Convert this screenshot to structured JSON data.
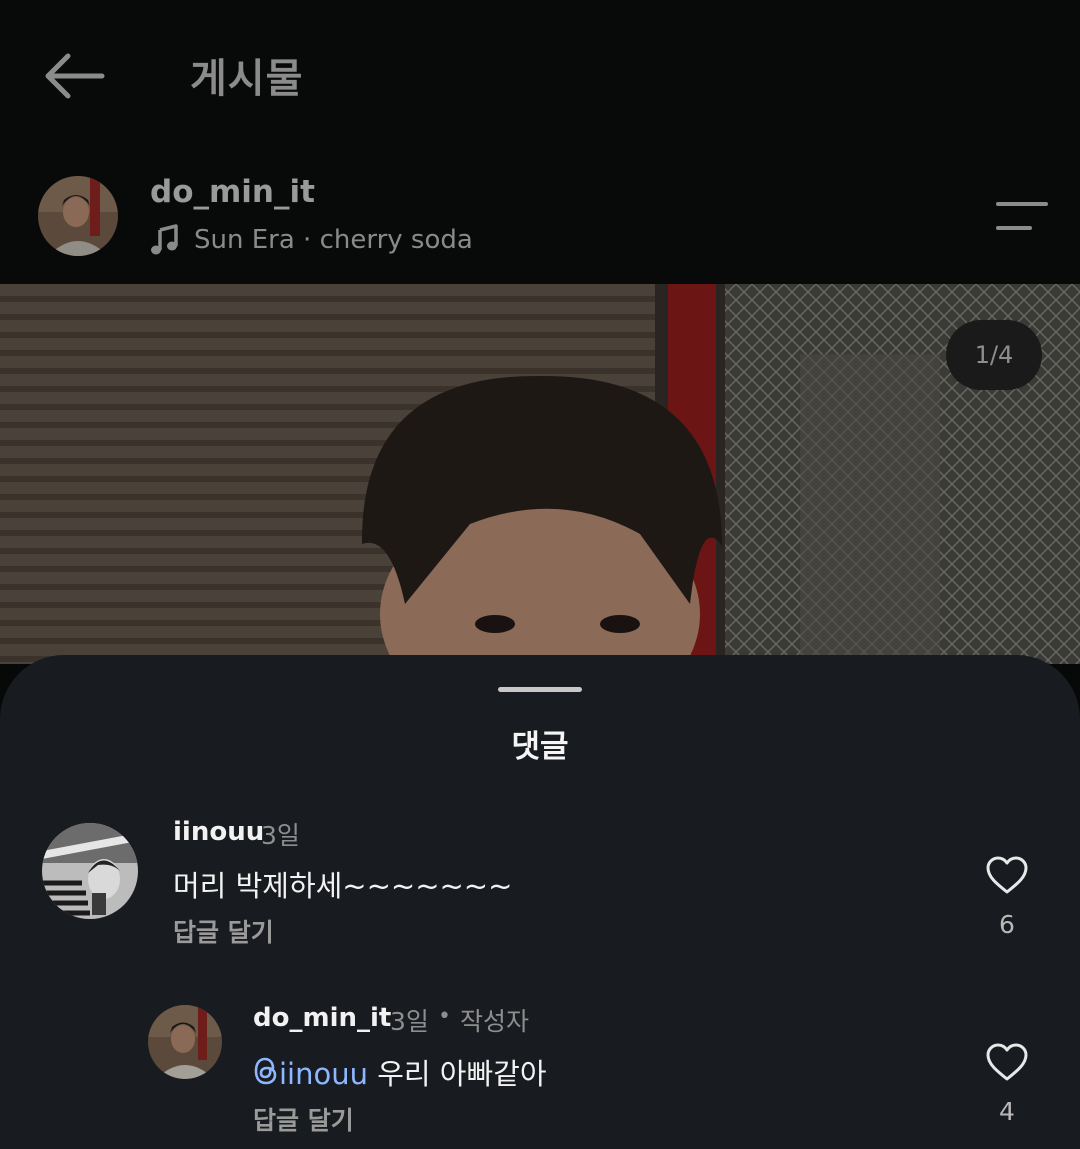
{
  "header": {
    "title": "게시물",
    "back_icon": "arrow-left-icon"
  },
  "post": {
    "username": "do_min_it",
    "music": "Sun Era · cherry soda",
    "music_icon": "music-note-icon",
    "menu_icon": "menu-icon",
    "photo_counter": "1/4"
  },
  "sheet": {
    "title": "댓글",
    "comments": [
      {
        "username": "iinouu",
        "time": "3일",
        "text": "머리 박제하세~~~~~~~",
        "reply_label": "답글 달기",
        "likes": "6"
      },
      {
        "username": "do_min_it",
        "time": "3일",
        "author_badge": "작성자",
        "mention": "iinouu",
        "text": " 우리 아빠같아",
        "reply_label": "답글 달기",
        "likes": "4"
      }
    ]
  },
  "colors": {
    "mention": "#8fb7ff",
    "sheet_bg": "#181b1f",
    "page_bg": "#070808"
  }
}
